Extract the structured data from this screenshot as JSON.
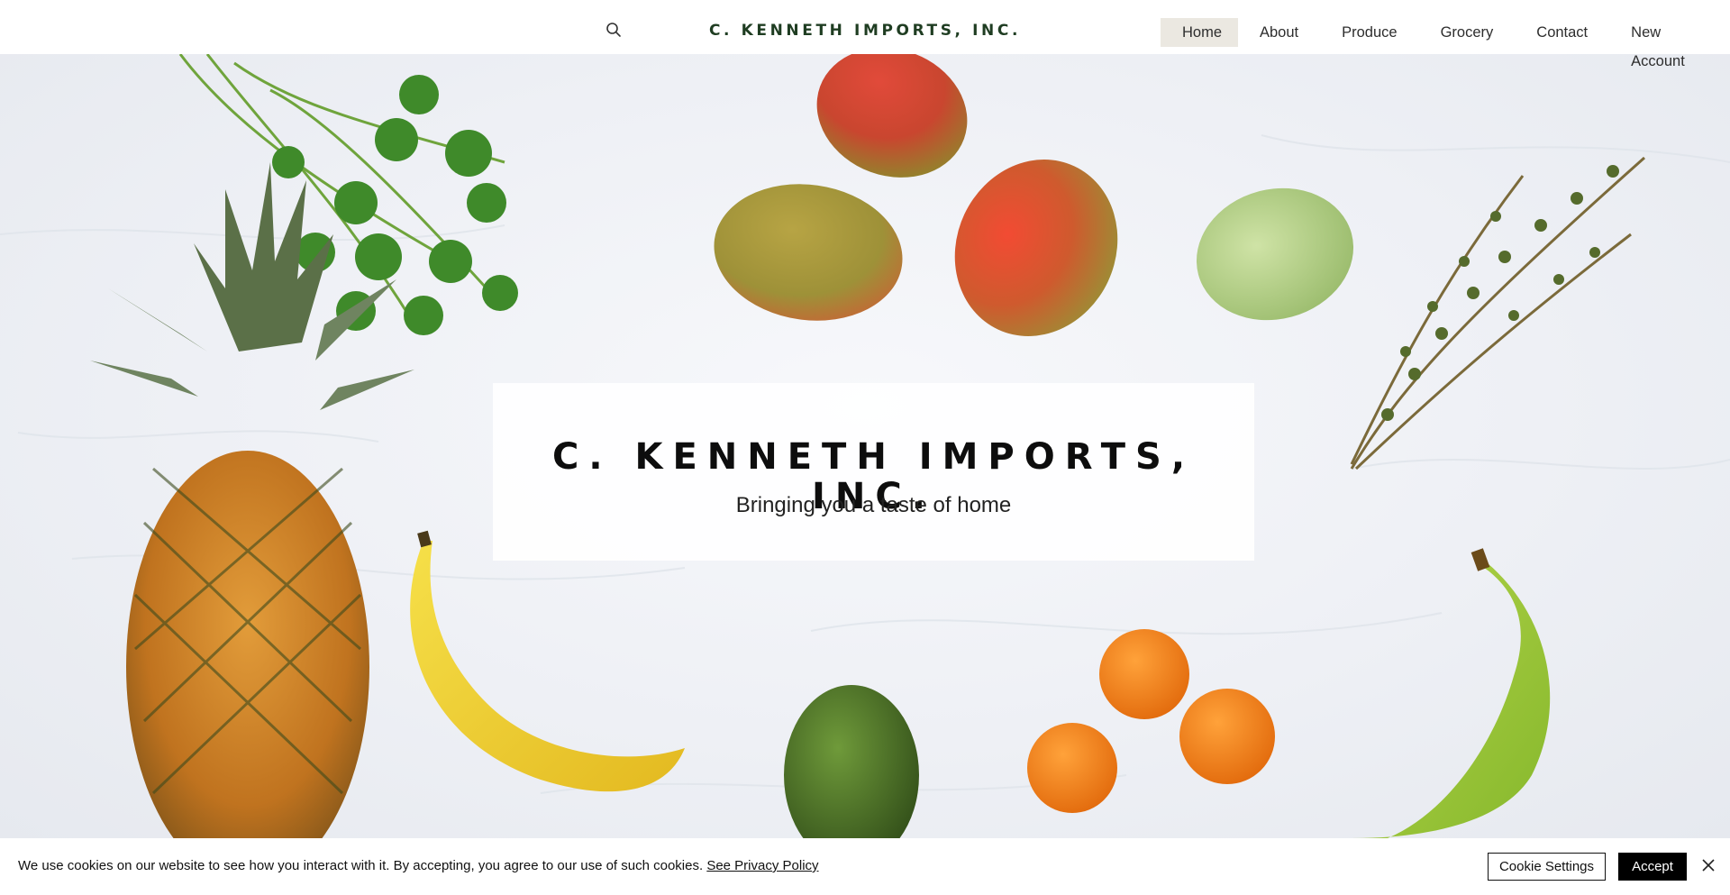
{
  "header": {
    "brand": "C. KENNETH IMPORTS, INC.",
    "search_icon": "search-icon",
    "nav": [
      {
        "label": "Home",
        "active": true
      },
      {
        "label": "About",
        "active": false
      },
      {
        "label": "Produce",
        "active": false
      },
      {
        "label": "Grocery",
        "active": false
      },
      {
        "label": "Contact",
        "active": false
      },
      {
        "label": "New Account",
        "active": false
      }
    ]
  },
  "hero": {
    "title": "C. KENNETH IMPORTS, INC.",
    "subtitle": "Bringing you a taste of home"
  },
  "cookie": {
    "message": "We use cookies on our website to see how you interact with it. By accepting, you agree to our use of such cookies.",
    "privacy_link": "See Privacy Policy",
    "settings_label": "Cookie Settings",
    "accept_label": "Accept",
    "close_icon": "close-icon"
  },
  "colors": {
    "brand": "#1f3d22",
    "nav_active_bg": "#ebe8e1",
    "accept_bg": "#000000"
  }
}
